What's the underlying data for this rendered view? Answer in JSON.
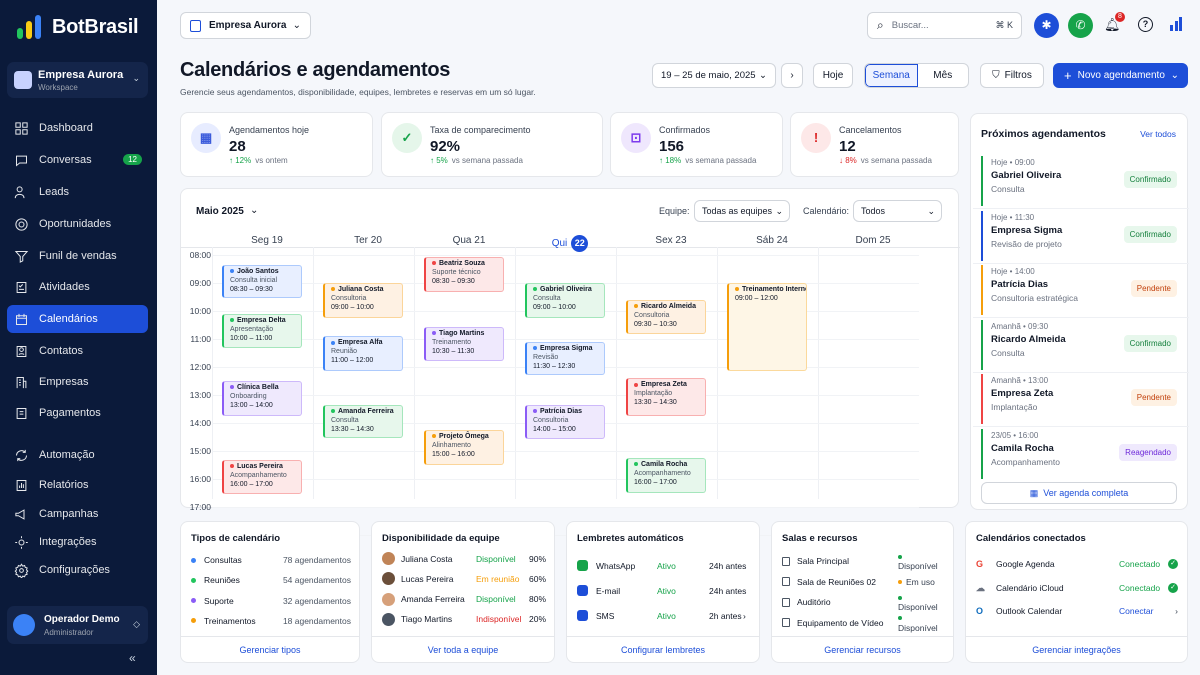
{
  "brand": {
    "name": "BotBrasil"
  },
  "workspace": {
    "name": "Empresa Aurora",
    "sub": "Workspace"
  },
  "nav": [
    {
      "label": "Dashboard",
      "icon": "dashboard-icon"
    },
    {
      "label": "Conversas",
      "icon": "chat-icon",
      "badge": "12"
    },
    {
      "label": "Leads",
      "icon": "users-icon"
    },
    {
      "label": "Oportunidades",
      "icon": "target-icon"
    },
    {
      "label": "Funil de vendas",
      "icon": "funnel-icon"
    },
    {
      "label": "Atividades",
      "icon": "checklist-icon"
    },
    {
      "label": "Calendários",
      "icon": "calendar-icon",
      "active": true
    },
    {
      "label": "Contatos",
      "icon": "contacts-icon"
    },
    {
      "label": "Empresas",
      "icon": "building-icon"
    },
    {
      "label": "Pagamentos",
      "icon": "payment-icon"
    },
    {
      "label": "Automação",
      "icon": "automation-icon"
    },
    {
      "label": "Relatórios",
      "icon": "reports-icon"
    },
    {
      "label": "Campanhas",
      "icon": "megaphone-icon"
    },
    {
      "label": "Integrações",
      "icon": "integrations-icon"
    },
    {
      "label": "Configurações",
      "icon": "settings-icon"
    }
  ],
  "operator": {
    "name": "Operador Demo",
    "role": "Administrador"
  },
  "topbar": {
    "company": "Empresa Aurora",
    "search_placeholder": "Buscar...",
    "shortcut": "⌘ K",
    "notif_count": "8"
  },
  "page": {
    "title": "Calendários e agendamentos",
    "subtitle": "Gerencie seus agendamentos, disponibilidade, equipes, lembretes e reservas em um só lugar."
  },
  "toolbar": {
    "range": "19 – 25 de maio, 2025",
    "today": "Hoje",
    "week": "Semana",
    "month": "Mês",
    "filters": "Filtros",
    "new": "Novo agendamento"
  },
  "kpis": [
    {
      "label": "Agendamentos hoje",
      "value": "28",
      "delta": "12%",
      "ref": "vs ontem",
      "dir": "up",
      "color": "#3b5bdb",
      "bg": "#e7ecff"
    },
    {
      "label": "Taxa de comparecimento",
      "value": "92%",
      "delta": "5%",
      "ref": "vs semana passada",
      "dir": "up",
      "color": "#16a34a",
      "bg": "#e5f6ea"
    },
    {
      "label": "Confirmados",
      "value": "156",
      "delta": "18%",
      "ref": "vs semana passada",
      "dir": "up",
      "color": "#7c3aed",
      "bg": "#efe7fd"
    },
    {
      "label": "Cancelamentos",
      "value": "12",
      "delta": "8%",
      "ref": "vs semana passada",
      "dir": "down",
      "color": "#dc2626",
      "bg": "#fde8e8"
    }
  ],
  "calendar": {
    "month": "Maio 2025",
    "team_label": "Equipe:",
    "team_value": "Todas as equipes",
    "cal_label": "Calendário:",
    "cal_value": "Todos",
    "days": [
      "Seg 19",
      "Ter 20",
      "Qua 21",
      "Qui",
      "Sex 23",
      "Sáb 24",
      "Dom 25"
    ],
    "today_num": "22",
    "hours": [
      "08:00",
      "09:00",
      "10:00",
      "11:00",
      "12:00",
      "13:00",
      "14:00",
      "15:00",
      "16:00",
      "17:00",
      "18:00"
    ],
    "events": [
      {
        "day": 0,
        "start": 9.25,
        "end": 10.5,
        "title": "João Santos",
        "sub": "Consulta inicial",
        "time": "08:30 – 09:30",
        "color": "#3b82f6",
        "bg": "#e8efff"
      },
      {
        "day": 0,
        "start": 11.0,
        "end": 12.3,
        "title": "Empresa Delta",
        "sub": "Apresentação",
        "time": "10:00 – 11:00",
        "color": "#22c55e",
        "bg": "#e7f7ec"
      },
      {
        "day": 0,
        "start": 13.4,
        "end": 14.7,
        "title": "Clínica Bella",
        "sub": "Onboarding",
        "time": "13:00 – 14:00",
        "color": "#8b5cf6",
        "bg": "#efe9fd"
      },
      {
        "day": 0,
        "start": 16.2,
        "end": 17.5,
        "title": "Lucas Pereira",
        "sub": "Acompanhamento",
        "time": "16:00 – 17:00",
        "color": "#ef4444",
        "bg": "#fde8e8"
      },
      {
        "day": 1,
        "start": 9.9,
        "end": 11.2,
        "title": "Juliana Costa",
        "sub": "Consultoria",
        "time": "09:00 – 10:00",
        "color": "#f59e0b",
        "bg": "#fef1e3"
      },
      {
        "day": 1,
        "start": 11.8,
        "end": 13.1,
        "title": "Empresa Alfa",
        "sub": "Reunião",
        "time": "11:00 – 12:00",
        "color": "#3b82f6",
        "bg": "#e8efff"
      },
      {
        "day": 1,
        "start": 14.25,
        "end": 15.5,
        "title": "Amanda Ferreira",
        "sub": "Consulta",
        "time": "13:30 – 14:30",
        "color": "#22c55e",
        "bg": "#e7f7ec"
      },
      {
        "day": 2,
        "start": 8.95,
        "end": 10.3,
        "title": "Beatriz Souza",
        "sub": "Suporte técnico",
        "time": "08:30 – 09:30",
        "color": "#ef4444",
        "bg": "#fde8e8"
      },
      {
        "day": 2,
        "start": 11.45,
        "end": 12.75,
        "title": "Tiago Martins",
        "sub": "Treinamento",
        "time": "10:30 – 11:30",
        "color": "#8b5cf6",
        "bg": "#efe9fd"
      },
      {
        "day": 2,
        "start": 15.15,
        "end": 16.45,
        "title": "Projeto Ômega",
        "sub": "Alinhamento",
        "time": "15:00 – 16:00",
        "color": "#f59e0b",
        "bg": "#fef1e3"
      },
      {
        "day": 3,
        "start": 9.9,
        "end": 11.2,
        "title": "Gabriel Oliveira",
        "sub": "Consulta",
        "time": "09:00 – 10:00",
        "color": "#22c55e",
        "bg": "#e7f7ec"
      },
      {
        "day": 3,
        "start": 12.0,
        "end": 13.25,
        "title": "Empresa Sigma",
        "sub": "Revisão",
        "time": "11:30 – 12:30",
        "color": "#3b82f6",
        "bg": "#e8efff"
      },
      {
        "day": 3,
        "start": 14.25,
        "end": 15.55,
        "title": "Patrícia Dias",
        "sub": "Consultoria",
        "time": "14:00 – 15:00",
        "color": "#8b5cf6",
        "bg": "#efe9fd"
      },
      {
        "day": 4,
        "start": 10.5,
        "end": 11.8,
        "title": "Ricardo Almeida",
        "sub": "Consultoria",
        "time": "09:30 – 10:30",
        "color": "#f59e0b",
        "bg": "#fef1e3"
      },
      {
        "day": 4,
        "start": 13.3,
        "end": 14.7,
        "title": "Empresa Zeta",
        "sub": "Implantação",
        "time": "13:30 – 14:30",
        "color": "#ef4444",
        "bg": "#fde8e8"
      },
      {
        "day": 4,
        "start": 16.15,
        "end": 17.45,
        "title": "Camila Rocha",
        "sub": "Acompanhamento",
        "time": "16:00 – 17:00",
        "color": "#22c55e",
        "bg": "#e7f7ec"
      },
      {
        "day": 5,
        "start": 9.9,
        "end": 13.1,
        "title": "Treinamento Interno",
        "sub": "",
        "time": "09:00 – 12:00",
        "color": "#f59e0b",
        "bg": "#fef6e6"
      }
    ]
  },
  "upcoming": {
    "title": "Próximos agendamentos",
    "see_all": "Ver todos",
    "items": [
      {
        "when": "Hoje • 09:00",
        "name": "Gabriel Oliveira",
        "type": "Consulta",
        "status": "Confirmado",
        "color": "#16a34a",
        "bg": "#e7f7ec"
      },
      {
        "when": "Hoje • 11:30",
        "name": "Empresa Sigma",
        "type": "Revisão de projeto",
        "status": "Confirmado",
        "color": "#1d4ed8",
        "bg": "#e7f7ec"
      },
      {
        "when": "Hoje • 14:00",
        "name": "Patrícia Dias",
        "type": "Consultoria estratégica",
        "status": "Pendente",
        "color": "#f59e0b",
        "bg": "#fef1e3"
      },
      {
        "when": "Amanhã • 09:30",
        "name": "Ricardo Almeida",
        "type": "Consulta",
        "status": "Confirmado",
        "color": "#16a34a",
        "bg": "#e7f7ec"
      },
      {
        "when": "Amanhã • 13:00",
        "name": "Empresa Zeta",
        "type": "Implantação",
        "status": "Pendente",
        "color": "#ef4444",
        "bg": "#fef1e3"
      },
      {
        "when": "23/05 • 16:00",
        "name": "Camila Rocha",
        "type": "Acompanhamento",
        "status": "Reagendado",
        "color": "#16a34a",
        "bg": "#efe9fd"
      }
    ],
    "full": "Ver agenda completa"
  },
  "types": {
    "title": "Tipos de calendário",
    "rows": [
      {
        "name": "Consultas",
        "count": "78 agendamentos",
        "color": "#3b82f6"
      },
      {
        "name": "Reuniões",
        "count": "54 agendamentos",
        "color": "#22c55e"
      },
      {
        "name": "Suporte",
        "count": "32 agendamentos",
        "color": "#8b5cf6"
      },
      {
        "name": "Treinamentos",
        "count": "18 agendamentos",
        "color": "#f59e0b"
      }
    ],
    "foot": "Gerenciar tipos"
  },
  "availability": {
    "title": "Disponibilidade da equipe",
    "rows": [
      {
        "name": "Juliana Costa",
        "status": "Disponível",
        "pct": "90%",
        "color": "#16a34a"
      },
      {
        "name": "Lucas Pereira",
        "status": "Em reunião",
        "pct": "60%",
        "color": "#f59e0b"
      },
      {
        "name": "Amanda Ferreira",
        "status": "Disponível",
        "pct": "80%",
        "color": "#16a34a"
      },
      {
        "name": "Tiago Martins",
        "status": "Indisponível",
        "pct": "20%",
        "color": "#dc2626"
      }
    ],
    "foot": "Ver toda a equipe"
  },
  "reminders": {
    "title": "Lembretes automáticos",
    "rows": [
      {
        "name": "WhatsApp",
        "status": "Ativo",
        "when": "24h antes",
        "color": "#16a34a"
      },
      {
        "name": "E-mail",
        "status": "Ativo",
        "when": "24h antes",
        "color": "#1d4ed8"
      },
      {
        "name": "SMS",
        "status": "Ativo",
        "when": "2h antes",
        "color": "#1d4ed8"
      }
    ],
    "foot": "Configurar lembretes"
  },
  "rooms": {
    "title": "Salas e recursos",
    "rows": [
      {
        "name": "Sala Principal",
        "status": "Disponível",
        "color": "#16a34a"
      },
      {
        "name": "Sala de Reuniões 02",
        "status": "Em uso",
        "color": "#f59e0b"
      },
      {
        "name": "Auditório",
        "status": "Disponível",
        "color": "#16a34a"
      },
      {
        "name": "Equipamento de Vídeo",
        "status": "Disponível",
        "color": "#16a34a"
      }
    ],
    "foot": "Gerenciar recursos"
  },
  "connected": {
    "title": "Calendários conectados",
    "rows": [
      {
        "name": "Google Agenda",
        "status": "Conectado"
      },
      {
        "name": "Calendário iCloud",
        "status": "Conectado"
      },
      {
        "name": "Outlook Calendar",
        "status": "Conectar"
      }
    ],
    "foot": "Gerenciar integrações"
  }
}
